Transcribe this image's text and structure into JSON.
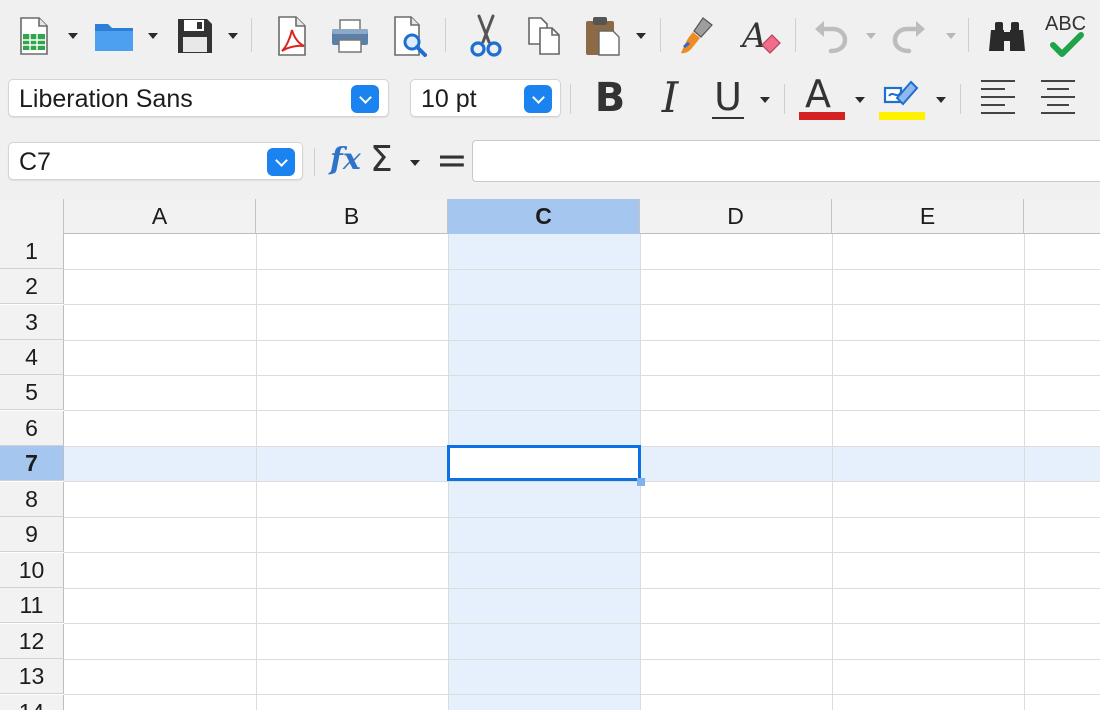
{
  "toolbar": {
    "buttons": [
      {
        "name": "new-spreadsheet-button",
        "icon": "new-spreadsheet-icon",
        "has_dropdown": true
      },
      {
        "name": "open-button",
        "icon": "folder-icon",
        "has_dropdown": true
      },
      {
        "name": "save-button",
        "icon": "floppy-disk-icon",
        "has_dropdown": true
      },
      {
        "name": "export-pdf-button",
        "icon": "pdf-icon"
      },
      {
        "name": "print-button",
        "icon": "printer-icon"
      },
      {
        "name": "print-preview-button",
        "icon": "print-preview-icon"
      },
      {
        "name": "cut-button",
        "icon": "scissors-icon"
      },
      {
        "name": "copy-button",
        "icon": "copy-icon"
      },
      {
        "name": "paste-button",
        "icon": "clipboard-icon",
        "has_dropdown": true
      },
      {
        "name": "clone-formatting-button",
        "icon": "paintbrush-icon"
      },
      {
        "name": "clear-formatting-button",
        "icon": "clear-format-icon"
      },
      {
        "name": "undo-button",
        "icon": "undo-icon",
        "has_dropdown": true,
        "enabled": false
      },
      {
        "name": "redo-button",
        "icon": "redo-icon",
        "has_dropdown": true,
        "enabled": false
      },
      {
        "name": "find-replace-button",
        "icon": "binoculars-icon"
      },
      {
        "name": "spelling-button",
        "icon": "spellcheck-icon",
        "label": "ABC"
      }
    ]
  },
  "format_bar": {
    "font_name": "Liberation Sans",
    "font_size": "10 pt",
    "bold_label": "B",
    "italic_label": "I",
    "underline_label": "U",
    "font_color_label": "A",
    "font_color": "#d42222",
    "highlight_color": "#fff200",
    "align_buttons": [
      "align-left-icon",
      "align-center-icon"
    ]
  },
  "formula_bar": {
    "name_box": "C7",
    "function_wizard_label": "fx",
    "sum_label": "Σ",
    "equals_label": "=",
    "formula": ""
  },
  "sheet": {
    "columns": [
      "A",
      "B",
      "C",
      "D",
      "E"
    ],
    "rows": [
      "1",
      "2",
      "3",
      "4",
      "5",
      "6",
      "7",
      "8",
      "9",
      "10",
      "11",
      "12",
      "13",
      "14"
    ],
    "selected_cell": "C7",
    "selected_column": "C",
    "selected_row": "7",
    "colors": {
      "selection_header": "#a5c6ee",
      "selection_fill": "#e6f0fc",
      "cursor": "#0a72e6"
    }
  }
}
